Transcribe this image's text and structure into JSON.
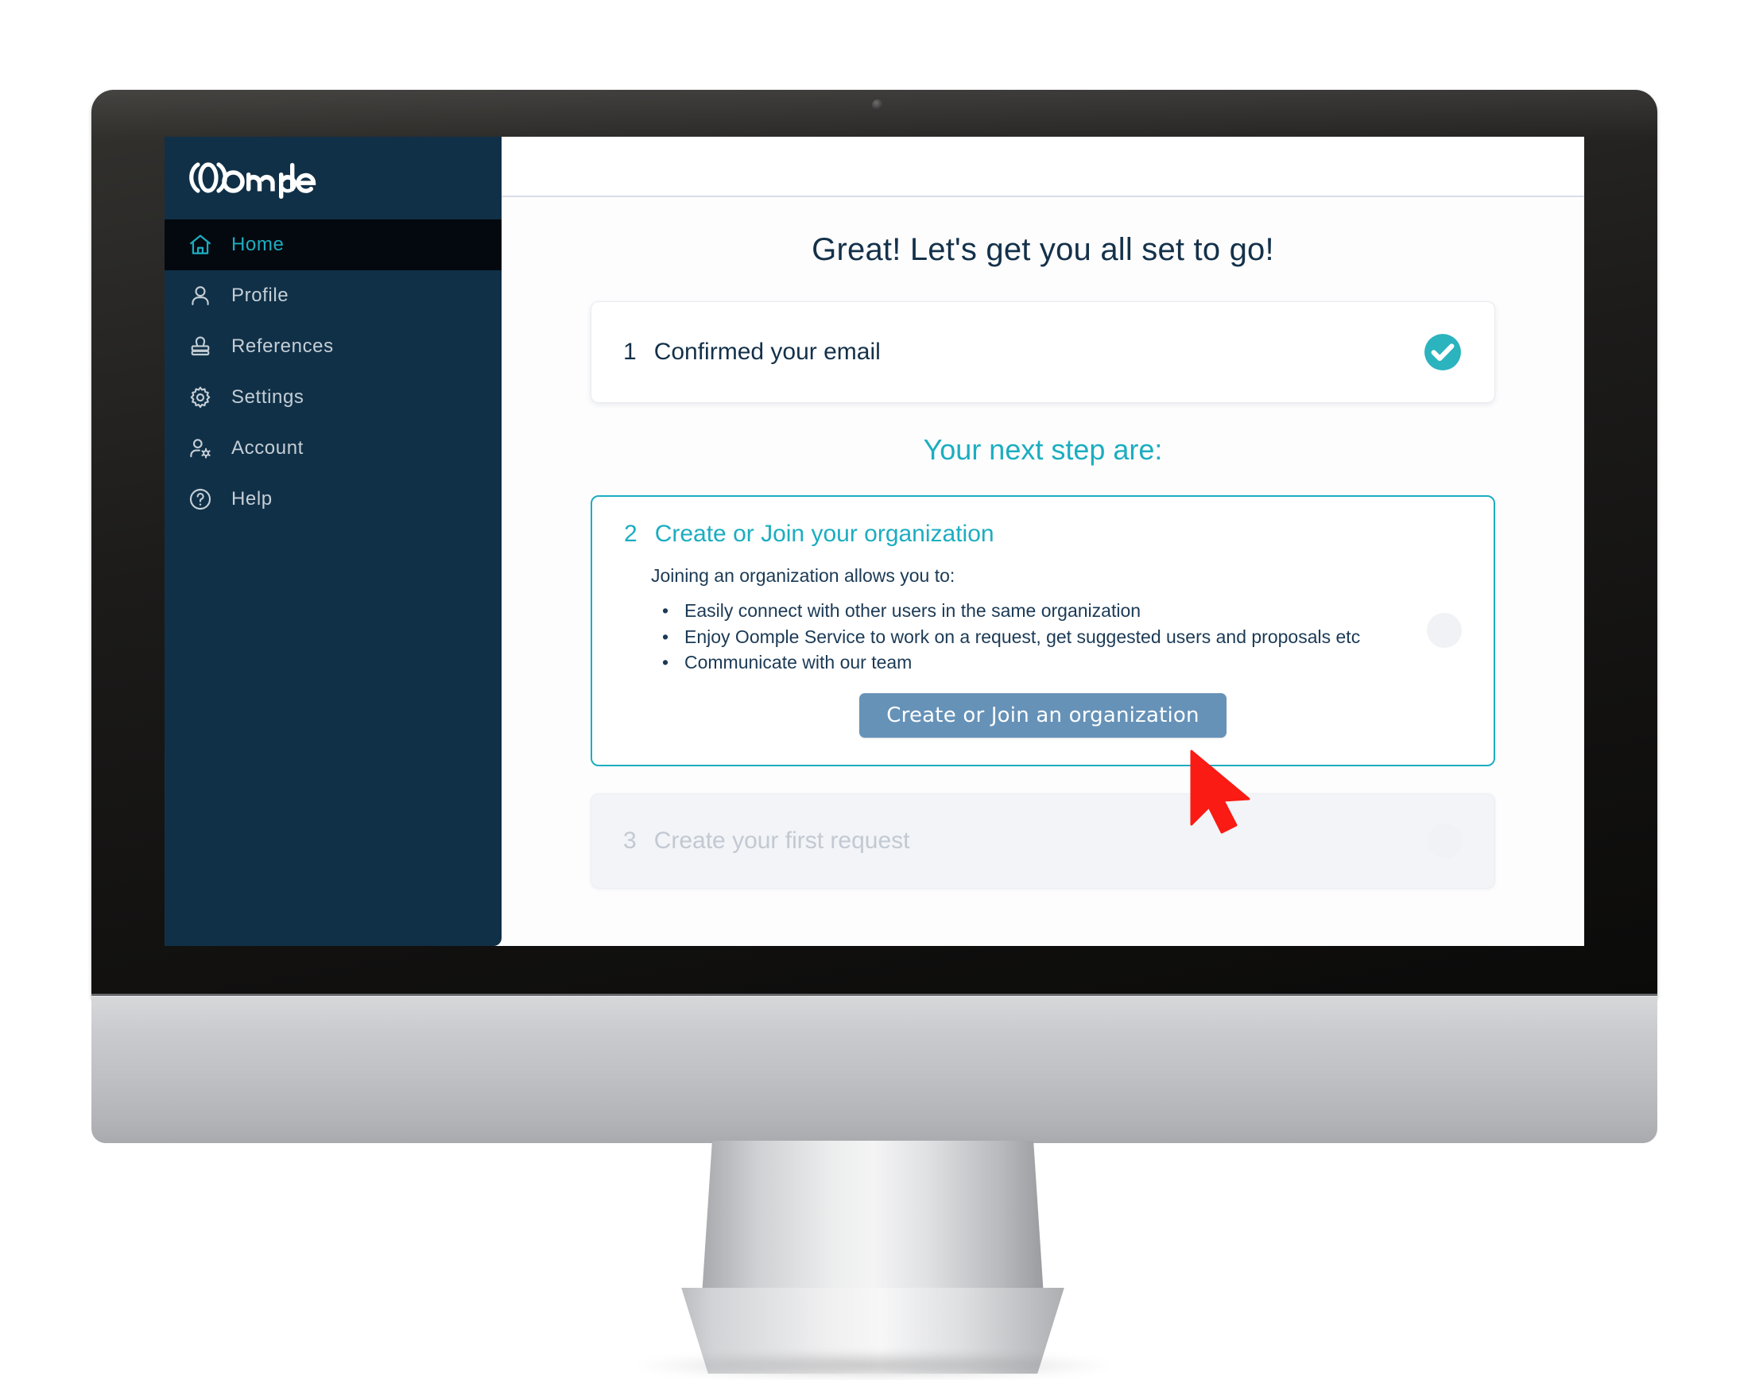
{
  "app": {
    "brand_name": "Oomple",
    "accent_teal": "#1CADC0",
    "sidebar_bg": "#103047",
    "sidebar_active_bg": "#04090f",
    "button_blue": "#6692b8",
    "cursor_red": "#f91b14",
    "text_navy": "#14314a"
  },
  "sidebar": {
    "items": [
      {
        "label": "Home",
        "icon": "home-icon",
        "active": true
      },
      {
        "label": "Profile",
        "icon": "person-icon",
        "active": false
      },
      {
        "label": "References",
        "icon": "stamp-icon",
        "active": false
      },
      {
        "label": "Settings",
        "icon": "gear-icon",
        "active": false
      },
      {
        "label": "Account",
        "icon": "person-gear-icon",
        "active": false
      },
      {
        "label": "Help",
        "icon": "question-circle-icon",
        "active": false
      }
    ]
  },
  "main": {
    "page_title": "Great! Let's get you all set to go!",
    "next_steps_heading": "Your next step are:",
    "steps": [
      {
        "number": "1",
        "title": "Confirmed your email",
        "state": "complete",
        "status_icon": "check-circle-icon"
      },
      {
        "number": "2",
        "title": "Create or Join your organization",
        "state": "current",
        "status_icon": "empty-circle-icon",
        "intro": "Joining an organization allows you to:",
        "bullets": [
          "Easily connect with other users in the same organization",
          "Enjoy Oomple Service to work on a request, get suggested users and proposals etc",
          "Communicate with our team"
        ],
        "button_label": "Create or Join an organization"
      },
      {
        "number": "3",
        "title": "Create your first request",
        "state": "disabled",
        "status_icon": "empty-circle-icon"
      }
    ]
  },
  "cursor": {
    "type": "arrow-pointer",
    "color": "#f91b14"
  }
}
